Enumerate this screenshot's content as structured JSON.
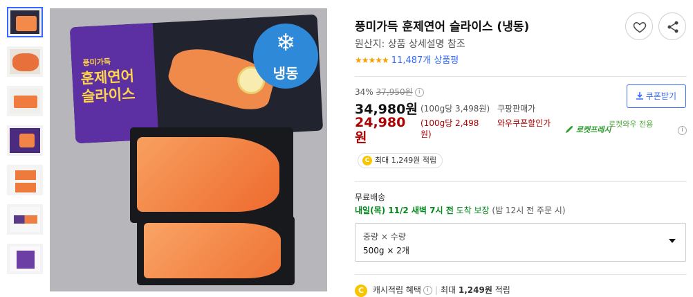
{
  "product": {
    "title": "풍미가득 훈제연어 슬라이스 (냉동)",
    "origin": "원산지: 상품 상세설명 참조",
    "rating_stars": "★★★★★",
    "review_count": "11,487개 상품평"
  },
  "package": {
    "brand": "풍미가득",
    "title": "훈제연어 슬라이스",
    "frozen_label": "냉동",
    "frozen_icon": "❄"
  },
  "thumbnails": [
    "thumb-1",
    "thumb-2",
    "thumb-3",
    "thumb-4",
    "thumb-5",
    "thumb-6",
    "thumb-7"
  ],
  "pricing": {
    "discount_rate": "34%",
    "original_price": "37,950원",
    "sale_price": "34,980원",
    "sale_unit_price": "(100g당 3,498원)",
    "seller": "쿠팡판매가",
    "wow_price": "24,980원",
    "wow_unit_price": "(100g당 2,498원)",
    "wow_label": "와우쿠폰할인가",
    "rocket_fresh": "로켓프레시",
    "rocket_wow": "로켓와우 전용",
    "coupon_button": "쿠폰받기",
    "cash_badge": "최대 1,249원 적립"
  },
  "shipping": {
    "type": "무료배송",
    "arrival": "내일(목) 11/2 새벽 7시 전",
    "guarantee": "도착 보장",
    "note": "(밤 12시 전 주문 시)"
  },
  "option": {
    "label": "중량 × 수량",
    "value": "500g × 2개"
  },
  "cash_benefit": {
    "label": "캐시적립 혜택",
    "detail_prefix": "최대",
    "amount": "1,249원",
    "suffix": "적립"
  },
  "colors": {
    "accent_blue": "#346aff",
    "wow_red": "#ae0000",
    "green": "#00891a",
    "star": "#f5a000"
  }
}
